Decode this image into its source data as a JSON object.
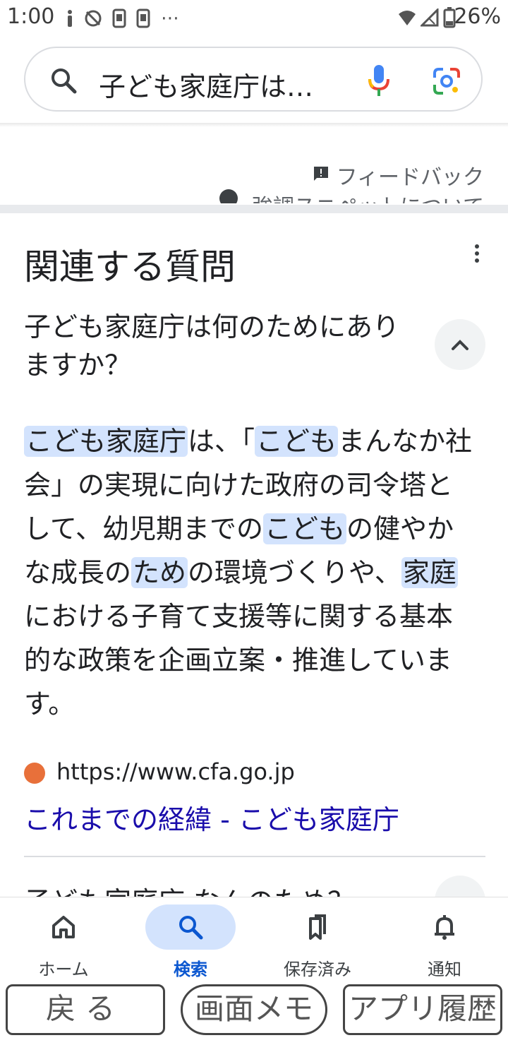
{
  "status_bar": {
    "time": "1:00",
    "battery": "26%",
    "notification_icons": [
      "info-icon",
      "no-sync-icon",
      "device-icon",
      "device-icon",
      "more-dots"
    ]
  },
  "search": {
    "query": "子ども家庭庁は…"
  },
  "snippet": {
    "feedback_label": "フィードバック",
    "about_label": "強調スニペットについて"
  },
  "related_questions": {
    "title": "関連する質問",
    "question1": "子ども家庭庁は何のためにありますか？",
    "answer_segments": [
      {
        "text": "こども家庭庁",
        "hl": true
      },
      {
        "text": "は、「",
        "hl": false
      },
      {
        "text": "こども",
        "hl": true
      },
      {
        "text": "まんなか社会」の実現に向けた政府の司令塔として、幼児期までの",
        "hl": false
      },
      {
        "text": "こども",
        "hl": true
      },
      {
        "text": "の健やかな成長の",
        "hl": false
      },
      {
        "text": "ため",
        "hl": true
      },
      {
        "text": "の環境づくりや、",
        "hl": false
      },
      {
        "text": "家庭",
        "hl": true
      },
      {
        "text": "における子育て支援等に関する基本的な政策を企画立案・推進しています。",
        "hl": false
      }
    ],
    "source_url": "https://www.cfa.go.jp",
    "source_title": "これまでの経緯 - こども家庭庁",
    "question2": "子ども家庭庁 なんのため？"
  },
  "bottom_nav": {
    "items": [
      {
        "label": "ホーム",
        "icon": "home-icon",
        "active": false
      },
      {
        "label": "検索",
        "icon": "search-icon",
        "active": true
      },
      {
        "label": "保存済み",
        "icon": "bookmarks-icon",
        "active": false
      },
      {
        "label": "通知",
        "icon": "bell-icon",
        "active": false
      }
    ]
  },
  "system_buttons": {
    "back": "戻る",
    "memo": "画面メモ",
    "history": "アプリ履歴"
  },
  "colors": {
    "link": "#1a0dab",
    "highlight": "#d3e3fd",
    "active_nav": "#0b57d0",
    "favicon": "#e8703a"
  }
}
